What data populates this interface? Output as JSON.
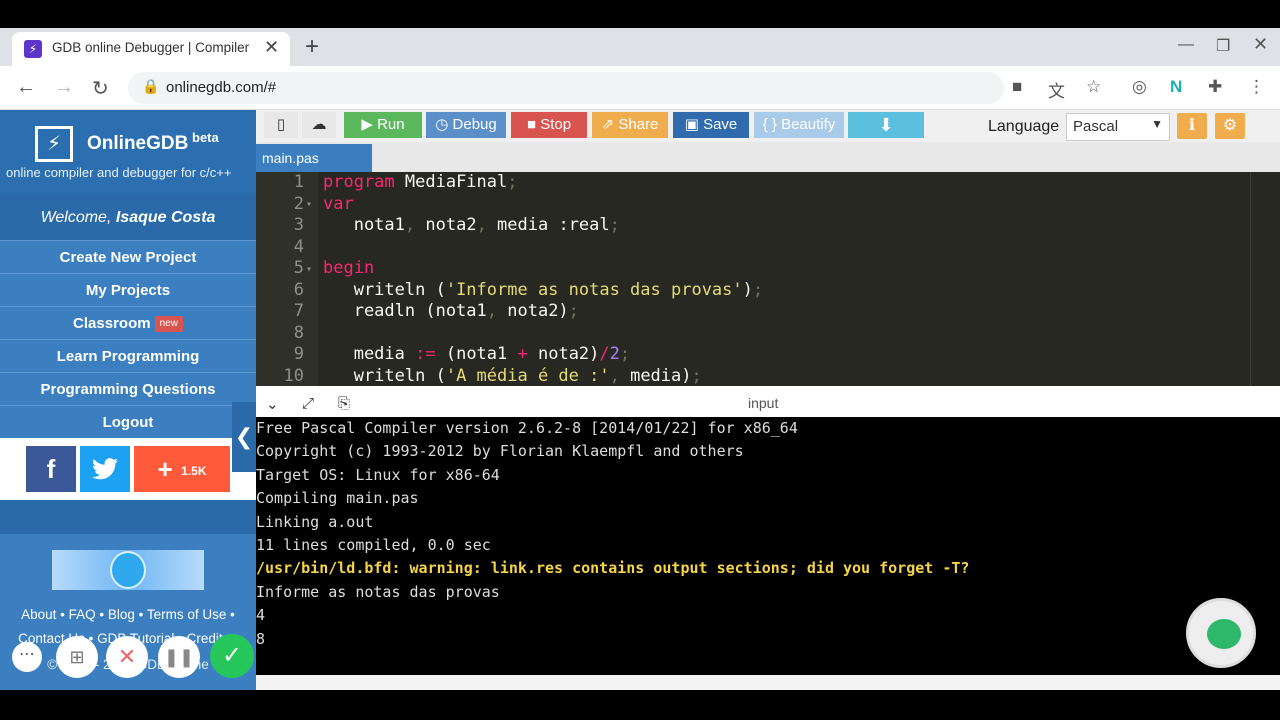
{
  "browser": {
    "tab_title": "GDB online Debugger | Compiler",
    "tab_close": "✕",
    "new_tab": "+",
    "url": "onlinegdb.com/#"
  },
  "sidebar": {
    "brand": "OnlineGDB",
    "beta": "beta",
    "tagline": "online compiler and debugger for c/c++",
    "welcome_prefix": "Welcome, ",
    "user_name": "Isaque Costa",
    "nav": [
      {
        "label": "Create New Project"
      },
      {
        "label": "My Projects"
      },
      {
        "label": "Classroom",
        "badge": "new"
      },
      {
        "label": "Learn Programming"
      },
      {
        "label": "Programming Questions"
      },
      {
        "label": "Logout"
      }
    ],
    "social": {
      "facebook": "f",
      "twitter": "🐦",
      "share_count": "1.5K",
      "share_plus": "+"
    },
    "footer": {
      "line1": "About • FAQ • Blog • Terms of Use •",
      "line2": "Contact Us • GDB Tutorial • Credits •",
      "line3": "© 2016 - 2021 GDB Online"
    },
    "collapse_glyph": "❮"
  },
  "toolbar": {
    "run": "Run",
    "debug": "Debug",
    "stop": "Stop",
    "share": "Share",
    "save": "Save",
    "beautify": "{ } Beautify",
    "language_label": "Language",
    "language_value": "Pascal"
  },
  "editor": {
    "file_tab": "main.pas",
    "line_numbers": [
      "1",
      "2",
      "3",
      "4",
      "5",
      "6",
      "7",
      "8",
      "9",
      "10"
    ]
  },
  "io": {
    "label": "input"
  },
  "console": {
    "lines": [
      "Free Pascal Compiler version 2.6.2-8 [2014/01/22] for x86_64",
      "Copyright (c) 1993-2012 by Florian Klaempfl and others",
      "Target OS: Linux for x86-64",
      "Compiling main.pas",
      "Linking a.out",
      "11 lines compiled, 0.0 sec"
    ],
    "warning": "/usr/bin/ld.bfd: warning: link.res contains output sections; did you forget -T?",
    "program_output": [
      "Informe as notas das provas",
      "4",
      "8"
    ]
  },
  "colors": {
    "sidebar_blue": "#3b7fc0",
    "run_green": "#5cb85c",
    "debug_blue": "#5b8fc9",
    "stop_red": "#d9534f",
    "share_orange": "#f0ad4e",
    "save_blue": "#2f6bad",
    "editor_bg": "#272822"
  }
}
